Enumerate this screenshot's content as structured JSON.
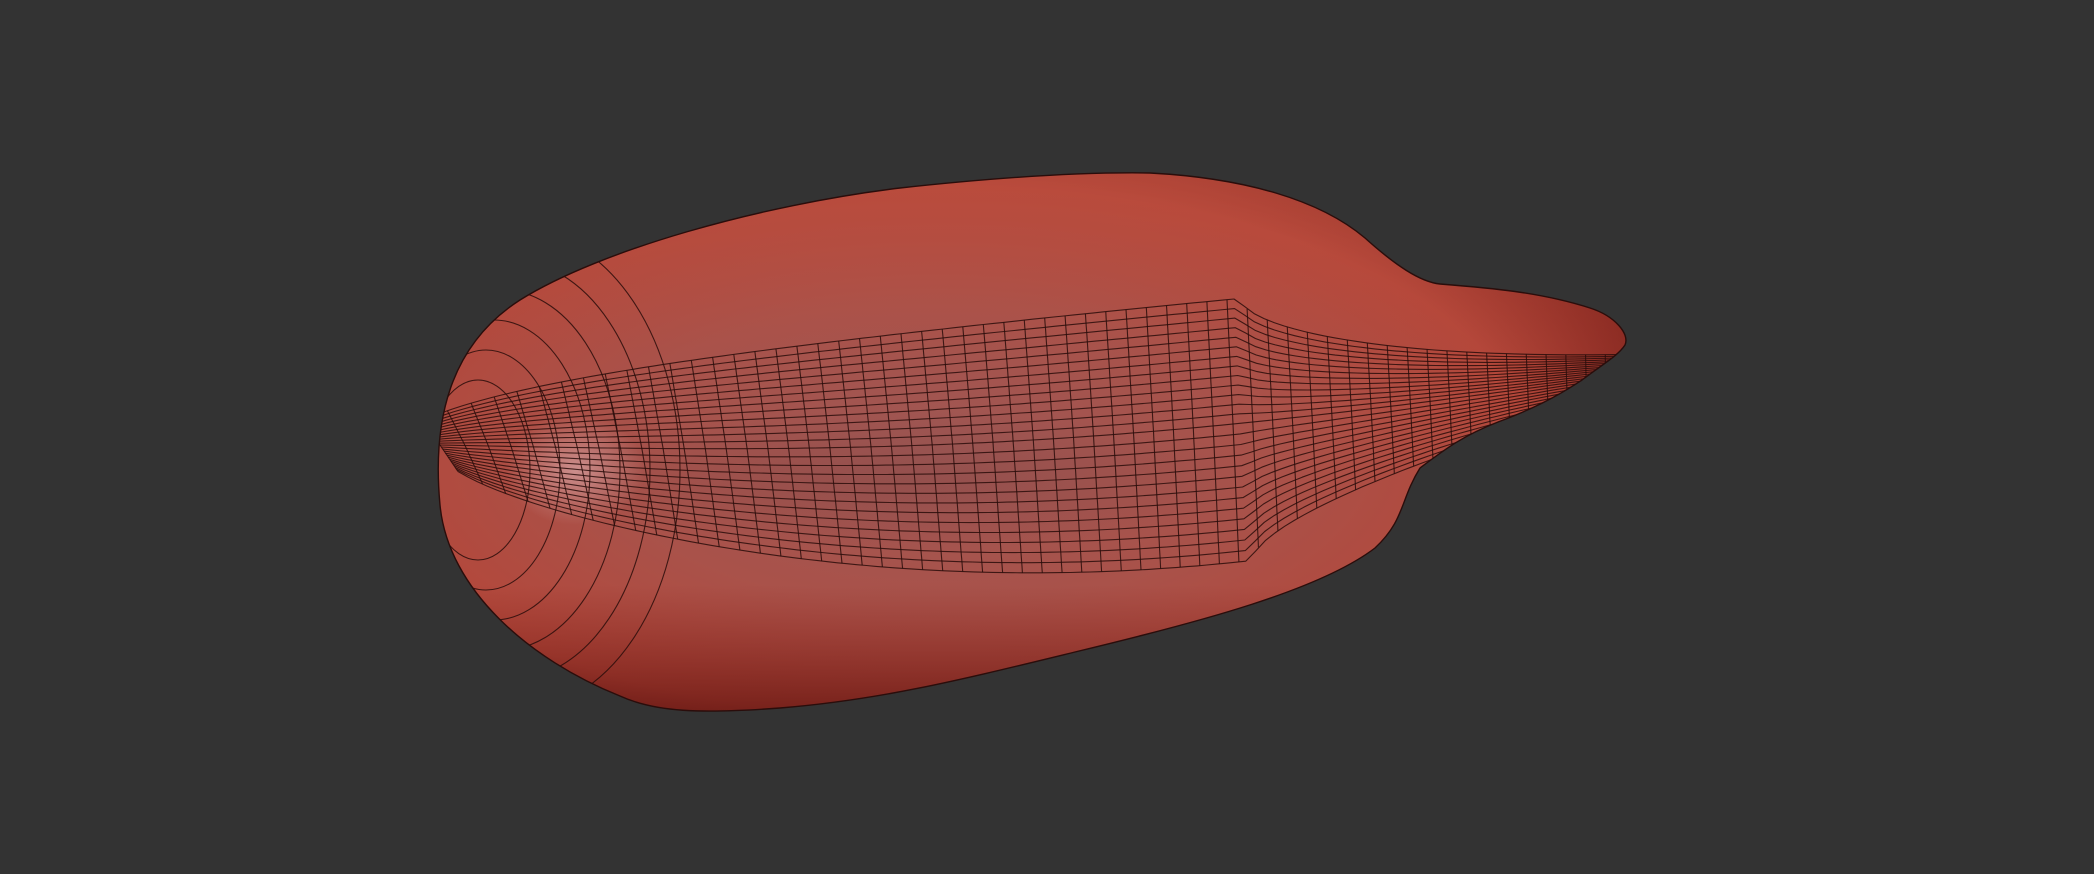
{
  "viewport": {
    "background_color": "#333333",
    "object": {
      "kind": "organic sculpt mesh",
      "base_color": "#b84a3c",
      "highlight_color": "#b97a78",
      "shadow_color": "#6e1c17",
      "wireframe_color": "#2a0d0b",
      "wireframe_visible": true
    }
  }
}
